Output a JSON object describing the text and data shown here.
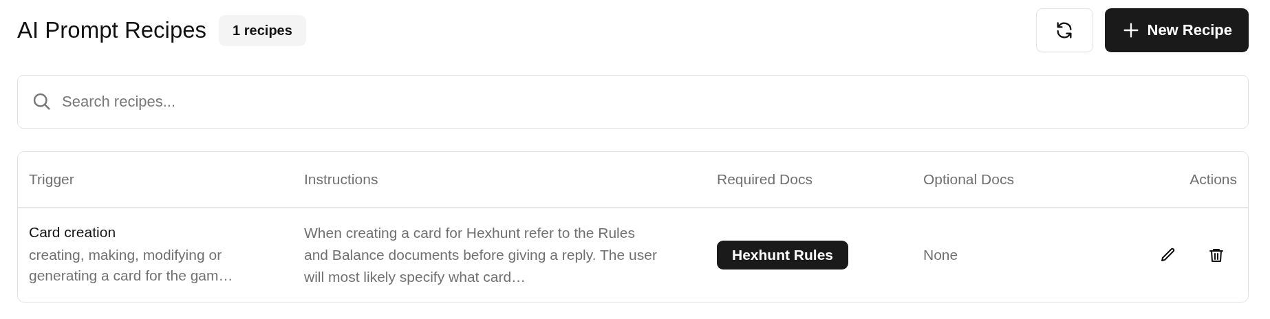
{
  "header": {
    "title": "AI Prompt Recipes",
    "count_badge": "1 recipes",
    "buttons": [
      {
        "kind": "refresh"
      },
      {
        "kind": "new",
        "label": "New Recipe"
      }
    ]
  },
  "search": {
    "placeholder": "Search recipes..."
  },
  "table": {
    "columns": [
      "Trigger",
      "Instructions",
      "Required Docs",
      "Optional Docs",
      "Actions"
    ],
    "rows": [
      {
        "trigger": "Card creation",
        "trigger_detail": "creating, making, modifying or generating a card for the gam…",
        "instructions": "When creating a card for Hexhunt refer to the Rules and Balance documents before giving a reply. The user will most likely specify what card…",
        "required_docs": [
          "Hexhunt Rules"
        ],
        "optional_docs": "None",
        "actions": [
          {
            "kind": "edit"
          },
          {
            "kind": "delete"
          }
        ]
      }
    ]
  }
}
